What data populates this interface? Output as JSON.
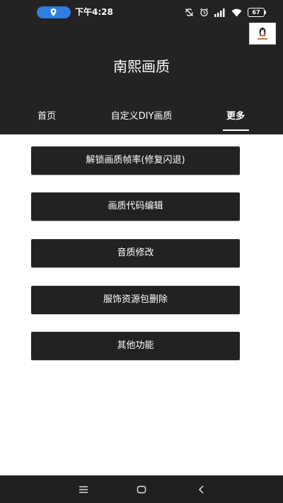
{
  "status_bar": {
    "time": "下午4:28",
    "battery": "67",
    "location_pill_color": "#2f7de1",
    "icons": [
      "location-icon",
      "sync-off-icon",
      "alarm-icon",
      "signal-icon",
      "wifi-icon",
      "battery-icon"
    ]
  },
  "header": {
    "title": "南熙画质",
    "background": "#232323"
  },
  "tabs": {
    "home": "首页",
    "diy": "自定义DIY画质",
    "more": "更多",
    "active": "more"
  },
  "buttons": {
    "unlock": "解锁画质帧率(修复闪退)",
    "code_edit": "画质代码编辑",
    "sound": "音质修改",
    "delete_clothes": "服饰资源包删除",
    "other": "其他功能"
  },
  "nav_bar": {
    "icons": [
      "menu-icon",
      "home-icon",
      "back-icon"
    ]
  }
}
